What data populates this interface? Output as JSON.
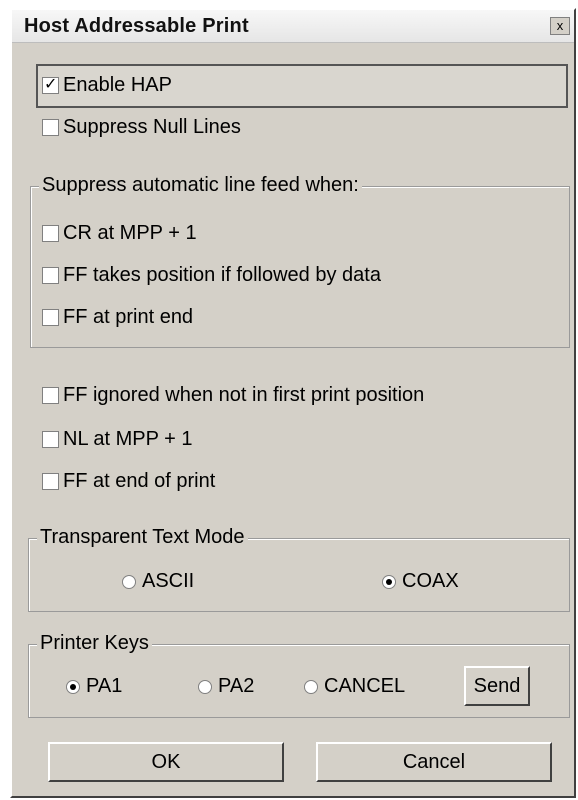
{
  "window": {
    "title": "Host Addressable Print",
    "close_glyph": "x"
  },
  "options": {
    "enable_hap": {
      "label": "Enable HAP",
      "checked": true
    },
    "suppress_null_lines": {
      "label": "Suppress Null Lines",
      "checked": false
    }
  },
  "auto_lf_group": {
    "title": "Suppress automatic line feed when:",
    "items": [
      {
        "label": "CR at MPP + 1",
        "checked": false
      },
      {
        "label": "FF takes position if followed by data",
        "checked": false
      },
      {
        "label": "FF at print end",
        "checked": false
      }
    ]
  },
  "misc": {
    "items": [
      {
        "label": "FF ignored when not in first print position",
        "checked": false
      },
      {
        "label": "NL at MPP + 1",
        "checked": false
      },
      {
        "label": "FF at end of print",
        "checked": false
      }
    ]
  },
  "transparent_mode": {
    "title": "Transparent Text Mode",
    "options": [
      {
        "label": "ASCII",
        "selected": false
      },
      {
        "label": "COAX",
        "selected": true
      }
    ]
  },
  "printer_keys": {
    "title": "Printer Keys",
    "options": [
      {
        "label": "PA1",
        "selected": true
      },
      {
        "label": "PA2",
        "selected": false
      },
      {
        "label": "CANCEL",
        "selected": false
      }
    ],
    "send_label": "Send"
  },
  "footer": {
    "ok_label": "OK",
    "cancel_label": "Cancel"
  },
  "colors": {
    "face": "#d4d0c8",
    "titlebar": "#efefef"
  }
}
